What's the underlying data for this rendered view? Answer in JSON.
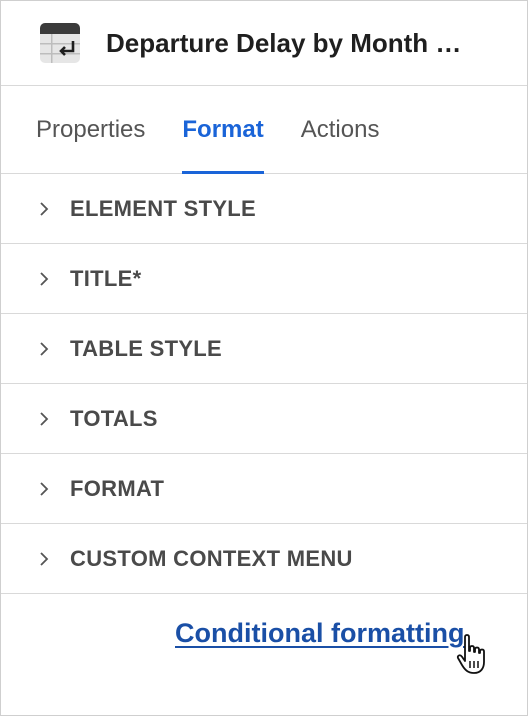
{
  "header": {
    "title": "Departure Delay by Month …",
    "icon": "table-icon"
  },
  "tabs": [
    {
      "label": "Properties",
      "active": false
    },
    {
      "label": "Format",
      "active": true
    },
    {
      "label": "Actions",
      "active": false
    }
  ],
  "sections": [
    {
      "label": "ELEMENT STYLE"
    },
    {
      "label": "TITLE*"
    },
    {
      "label": "TABLE STYLE"
    },
    {
      "label": "TOTALS"
    },
    {
      "label": "FORMAT"
    },
    {
      "label": "CUSTOM CONTEXT MENU"
    }
  ],
  "footer": {
    "link_label": "Conditional formatting"
  },
  "colors": {
    "accent": "#1a64d8",
    "link": "#1a4fa6",
    "section_text": "#4a4a4a"
  }
}
